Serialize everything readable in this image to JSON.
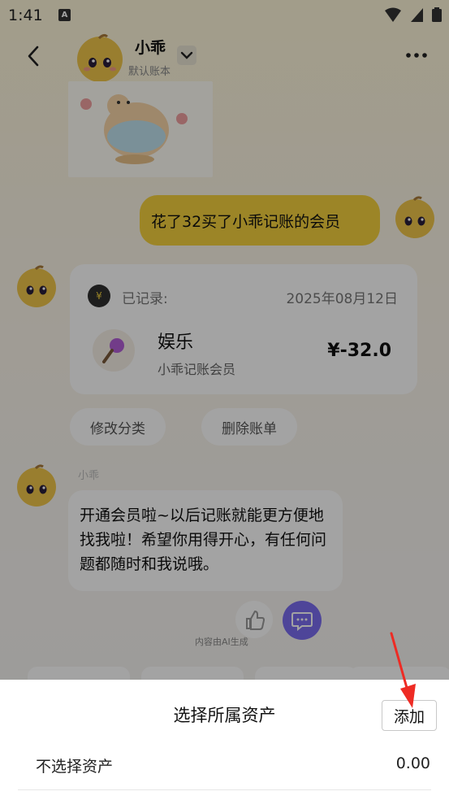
{
  "status_bar": {
    "time": "1:41",
    "notification_letter": "A"
  },
  "header": {
    "title": "小乖",
    "subtitle": "默认账本"
  },
  "user_message": {
    "text": "花了32买了小乖记账的会员"
  },
  "record_card": {
    "label": "已记录:",
    "date": "2025年08月12日",
    "category": "娱乐",
    "note": "小乖记账会员",
    "amount": "¥-32.0",
    "badge_symbol": "¥"
  },
  "actions": {
    "edit_category": "修改分类",
    "delete_bill": "删除账单"
  },
  "bot": {
    "name": "小乖",
    "message": "开通会员啦~以后记账就能更方便地找我啦！希望你用得开心，有任何问题都随时和我说哦。"
  },
  "ai_note": "内容由AI生成",
  "sheet": {
    "title": "选择所属资产",
    "add_button": "添加",
    "rows": [
      {
        "label": "不选择资产",
        "value": "0.00"
      }
    ]
  },
  "colors": {
    "accent_yellow": "#f4d13e",
    "chat_purple": "#7b6cf0",
    "annotation_red": "#ee2b24"
  }
}
